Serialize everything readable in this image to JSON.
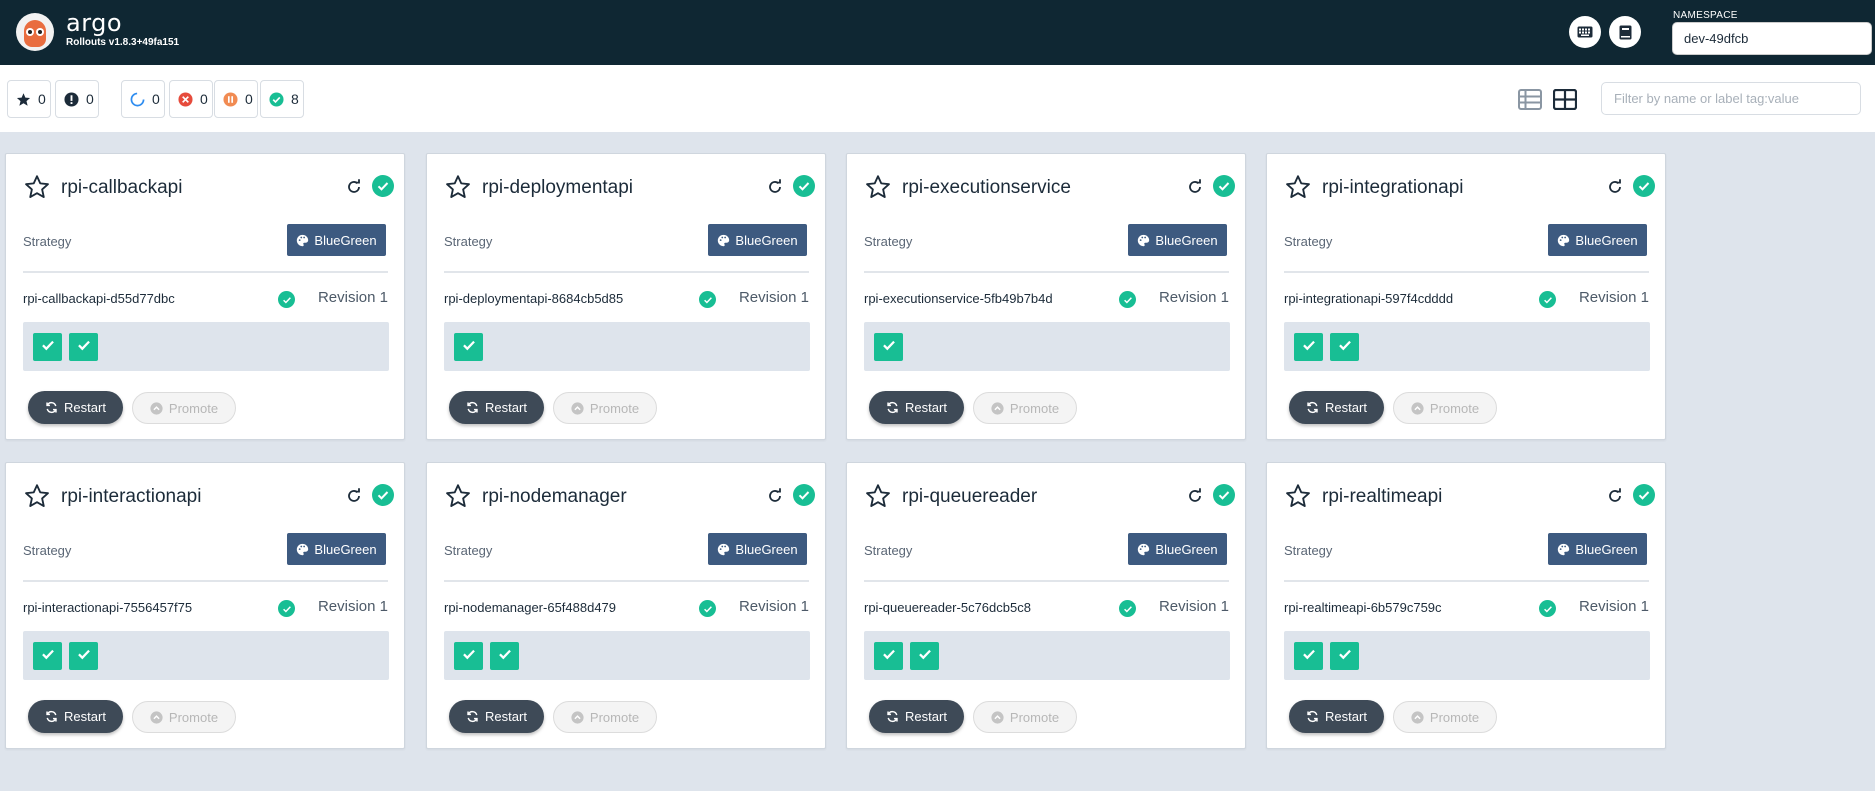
{
  "header": {
    "brand": "argo",
    "version": "Rollouts v1.8.3+49fa151",
    "namespace_label": "NAMESPACE",
    "namespace_value": "dev-49dfcb",
    "icons": [
      "keyboard-icon",
      "book-icon"
    ]
  },
  "filters": {
    "favorites": "0",
    "errors": "0",
    "progressing": "0",
    "degraded": "0",
    "paused": "0",
    "healthy": "8",
    "search_placeholder": "Filter by name or label tag:value"
  },
  "colors": {
    "header_bg": "#0f2733",
    "healthy": "#18be94",
    "strategy_badge": "#3d5a80",
    "restart_button": "#3e4a57",
    "page_bg": "#dee4ec"
  },
  "strategy_label": "Strategy",
  "restart_label": "Restart",
  "promote_label": "Promote",
  "rollouts": [
    {
      "name": "rpi-callbackapi",
      "strategy": "BlueGreen",
      "replicaset": "rpi-callbackapi-d55d77dbc",
      "revision": "Revision 1",
      "pods": 2
    },
    {
      "name": "rpi-deploymentapi",
      "strategy": "BlueGreen",
      "replicaset": "rpi-deploymentapi-8684cb5d85",
      "revision": "Revision 1",
      "pods": 1
    },
    {
      "name": "rpi-executionservice",
      "strategy": "BlueGreen",
      "replicaset": "rpi-executionservice-5fb49b7b4d",
      "revision": "Revision 1",
      "pods": 1
    },
    {
      "name": "rpi-integrationapi",
      "strategy": "BlueGreen",
      "replicaset": "rpi-integrationapi-597f4cdddd",
      "revision": "Revision 1",
      "pods": 2
    },
    {
      "name": "rpi-interactionapi",
      "strategy": "BlueGreen",
      "replicaset": "rpi-interactionapi-7556457f75",
      "revision": "Revision 1",
      "pods": 2
    },
    {
      "name": "rpi-nodemanager",
      "strategy": "BlueGreen",
      "replicaset": "rpi-nodemanager-65f488d479",
      "revision": "Revision 1",
      "pods": 2
    },
    {
      "name": "rpi-queuereader",
      "strategy": "BlueGreen",
      "replicaset": "rpi-queuereader-5c76dcb5c8",
      "revision": "Revision 1",
      "pods": 2
    },
    {
      "name": "rpi-realtimeapi",
      "strategy": "BlueGreen",
      "replicaset": "rpi-realtimeapi-6b579c759c",
      "revision": "Revision 1",
      "pods": 2
    }
  ]
}
